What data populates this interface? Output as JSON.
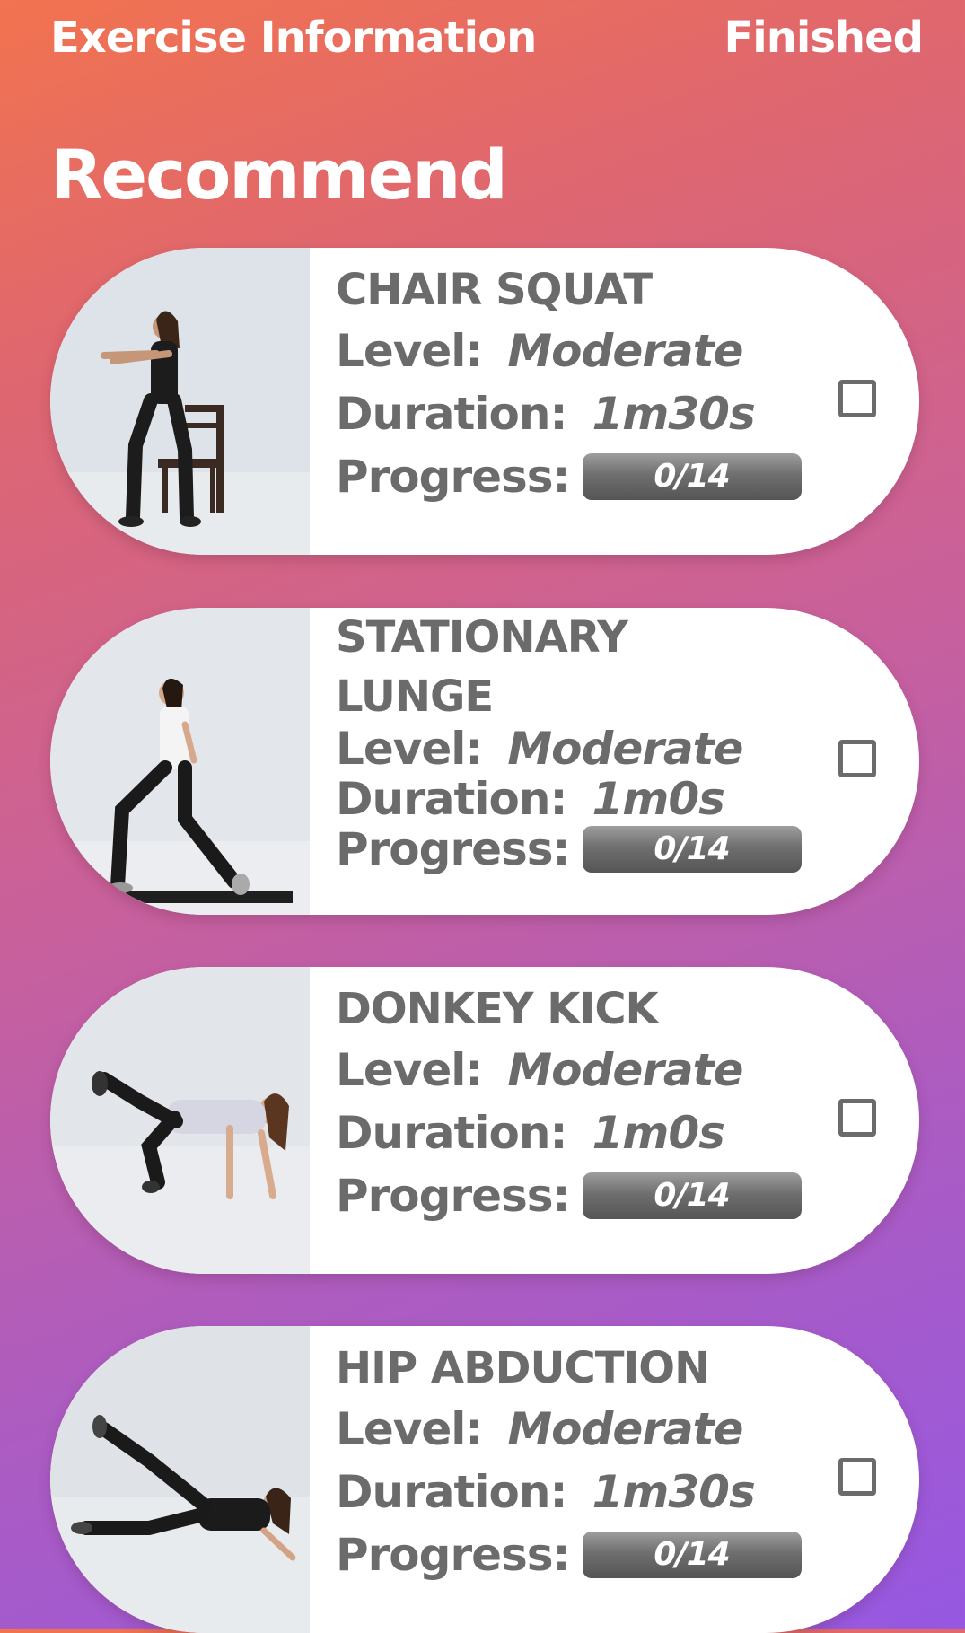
{
  "header": {
    "title": "Exercise Information",
    "finished_label": "Finished"
  },
  "section_title": "Recommend",
  "labels": {
    "level": "Level:",
    "duration": "Duration:",
    "progress": "Progress:"
  },
  "exercises": [
    {
      "name": "CHAIR SQUAT",
      "level": "Moderate",
      "duration": "1m30s",
      "progress_text": "0/14",
      "progress_fraction": 0,
      "checked": false,
      "photo_icon": "chair-squat-photo"
    },
    {
      "name": "STATIONARY LUNGE",
      "level": "Moderate",
      "duration": "1m0s",
      "progress_text": "0/14",
      "progress_fraction": 0,
      "checked": false,
      "photo_icon": "stationary-lunge-photo"
    },
    {
      "name": "DONKEY KICK",
      "level": "Moderate",
      "duration": "1m0s",
      "progress_text": "0/14",
      "progress_fraction": 0,
      "checked": false,
      "photo_icon": "donkey-kick-photo"
    },
    {
      "name": "HIP ABDUCTION",
      "level": "Moderate",
      "duration": "1m30s",
      "progress_text": "0/14",
      "progress_fraction": 0,
      "checked": false,
      "photo_icon": "hip-abduction-photo"
    }
  ],
  "colors": {
    "gradient_top": "#f2734f",
    "gradient_bottom": "#9658e2",
    "card_text": "#6b6b6b",
    "progress_bar": "#6f6f6f"
  }
}
